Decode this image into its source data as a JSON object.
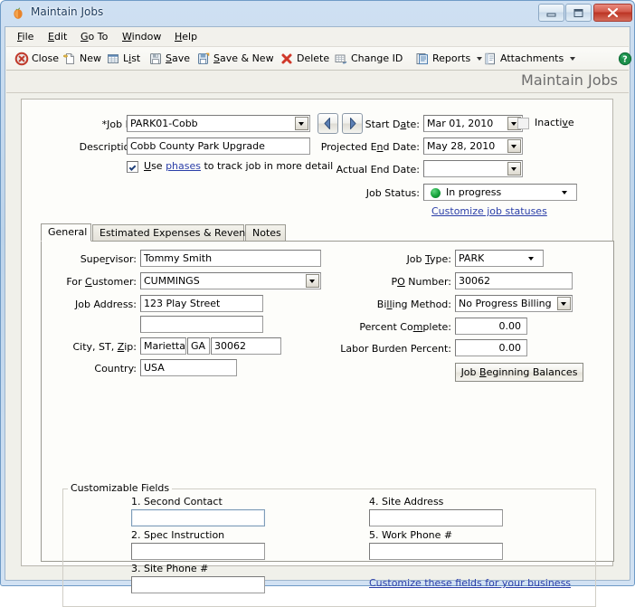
{
  "window": {
    "title": "Maintain Jobs",
    "icon": "peach-logo-icon",
    "minimize_label": "Minimize",
    "maximize_label": "Maximize",
    "close_label": "Close"
  },
  "menubar": {
    "items": [
      {
        "label": "File",
        "accel": "F"
      },
      {
        "label": "Edit",
        "accel": "E"
      },
      {
        "label": "Go To",
        "accel": "G"
      },
      {
        "label": "Window",
        "accel": "W"
      },
      {
        "label": "Help",
        "accel": "H"
      }
    ]
  },
  "toolbar": {
    "items": [
      {
        "label": "Close",
        "accel": "",
        "icon": "close-circle-icon",
        "caret": false
      },
      {
        "label": "New",
        "accel": "",
        "icon": "new-page-icon",
        "caret": false
      },
      {
        "label": "List",
        "accel": "i",
        "icon": "list-grid-icon",
        "caret": false
      },
      {
        "label": "Save",
        "accel": "S",
        "icon": "save-disk-icon",
        "caret": false
      },
      {
        "label": "Save & New",
        "accel": "S",
        "icon": "save-new-icon",
        "caret": false
      },
      {
        "label": "Delete",
        "accel": "",
        "icon": "delete-x-icon",
        "caret": false
      },
      {
        "label": "Change ID",
        "accel": "",
        "icon": "change-id-icon",
        "caret": false
      },
      {
        "label": "Reports",
        "accel": "",
        "icon": "reports-icon",
        "caret": true
      },
      {
        "label": "Attachments",
        "accel": "",
        "icon": "attachments-icon",
        "caret": true
      }
    ],
    "help_icon": "help-question-icon"
  },
  "banner": {
    "title": "Maintain Jobs"
  },
  "header": {
    "job_id_label": "Job ID:",
    "job_id_required": "*",
    "job_id_accel": "Job ID",
    "job_id_value": "PARK01-Cobb",
    "description_label": "Description:",
    "description_value": "Cobb County Park Upgrade",
    "use_phases_checked": true,
    "use_phases_text_1": "Use ",
    "use_phases_link": "phases",
    "use_phases_text_2": " to track job in more detail",
    "prev_button": "previous-record",
    "next_button": "next-record",
    "start_date_label": "Start Date:",
    "start_date_value": "Mar 01, 2010",
    "projected_end_label": "Projected End Date:",
    "projected_end_value": "May 28, 2010",
    "actual_end_label": "Actual End Date:",
    "actual_end_value": "",
    "job_status_label": "Job Status:",
    "job_status_value": "In progress",
    "job_status_color": "#139a2e",
    "customize_statuses_link": "Customize job statuses",
    "inactive_label": "Inactive",
    "inactive_checked": false
  },
  "tabs": [
    {
      "label": "General",
      "active": true
    },
    {
      "label": "Estimated Expenses & Revenue",
      "active": false
    },
    {
      "label": "Notes",
      "active": false
    }
  ],
  "general": {
    "left": {
      "supervisor_label": "Supervisor:",
      "supervisor_value": "Tommy Smith",
      "customer_label": "For Customer:",
      "customer_value": "CUMMINGS",
      "job_address_label": "Job Address:",
      "job_address_1": "123 Play Street",
      "job_address_2": "",
      "city_st_zip_label": "City, ST, Zip:",
      "city_value": "Marietta",
      "state_value": "GA",
      "zip_value": "30062",
      "country_label": "Country:",
      "country_value": "USA"
    },
    "right": {
      "job_type_label": "Job Type:",
      "job_type_value": "PARK",
      "po_number_label": "PO Number:",
      "po_number_value": "30062",
      "billing_method_label": "Billing Method:",
      "billing_method_value": "No Progress Billing",
      "percent_complete_label": "Percent Complete:",
      "percent_complete_value": "0.00",
      "labor_burden_label": "Labor Burden Percent:",
      "labor_burden_value": "0.00",
      "beginning_balances_button": "Job Beginning Balances"
    },
    "customizable": {
      "group_title": "Customizable Fields",
      "fields": [
        {
          "label": "1. Second Contact",
          "value": "",
          "focused": true
        },
        {
          "label": "2. Spec Instruction",
          "value": "",
          "focused": false
        },
        {
          "label": "3. Site Phone #",
          "value": "",
          "focused": false
        },
        {
          "label": "4. Site Address",
          "value": "",
          "focused": false
        },
        {
          "label": "5. Work Phone #",
          "value": "",
          "focused": false
        }
      ],
      "customize_link": "Customize these fields for your business"
    }
  }
}
